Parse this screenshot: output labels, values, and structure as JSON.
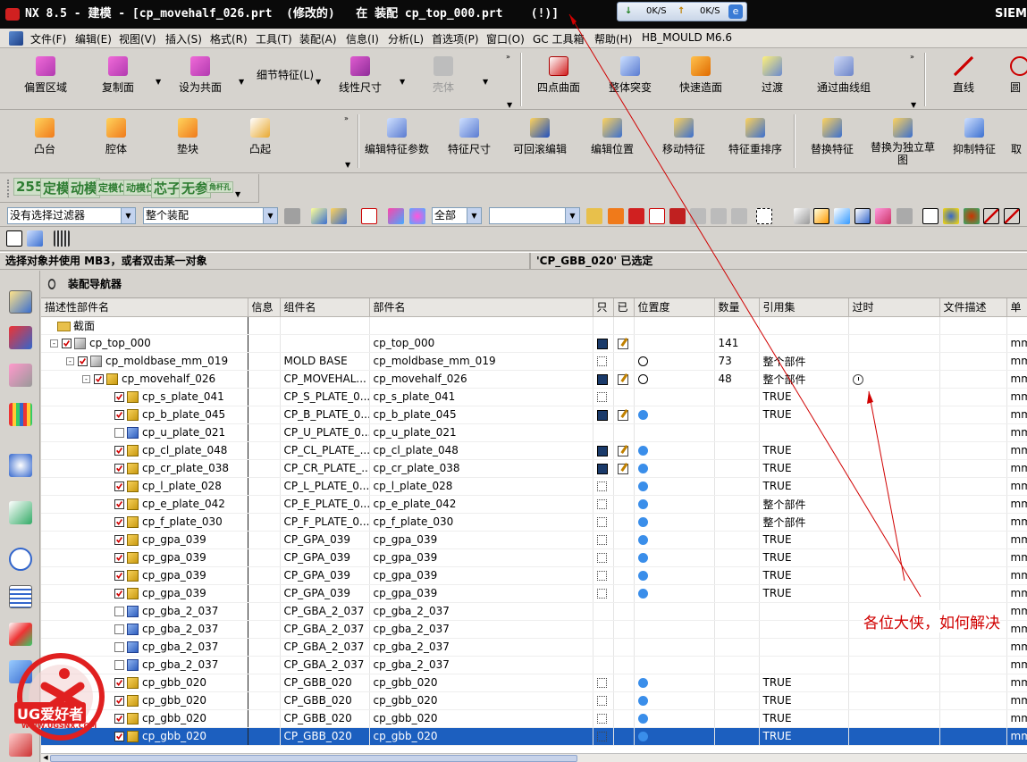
{
  "titlebar": {
    "text": "NX 8.5 - 建模 - [cp_movehalf_026.prt  (修改的)   在 装配 cp_top_000.prt    (!)]",
    "brand": "SIEM",
    "net_down": "0K/S",
    "net_up": "0K/S"
  },
  "menu": [
    "文件(F)",
    "编辑(E)",
    "视图(V)",
    "插入(S)",
    "格式(R)",
    "工具(T)",
    "装配(A)",
    "信息(I)",
    "分析(L)",
    "首选项(P)",
    "窗口(O)",
    "GC 工具箱",
    "帮助(H)",
    "HB_MOULD M6.6"
  ],
  "toolbar1": {
    "buttons": [
      "偏置区域",
      "复制面",
      "设为共面",
      "细节特征(L)",
      "线性尺寸",
      "壳体",
      "四点曲面",
      "整体突变",
      "快速造面",
      "过渡",
      "通过曲线组",
      "直线",
      "圆"
    ]
  },
  "toolbar2": {
    "buttons": [
      "凸台",
      "腔体",
      "垫块",
      "凸起",
      "编辑特征参数",
      "特征尺寸",
      "可回滚编辑",
      "编辑位置",
      "移动特征",
      "特征重排序",
      "替换特征",
      "替换为独立草图",
      "抑制特征",
      "取"
    ]
  },
  "toolbar3": {
    "labels": [
      "255",
      "定模",
      "动模",
      "定模仁",
      "动模仁",
      "芯子",
      "无参",
      "角杆孔"
    ]
  },
  "filters": {
    "selection_filter": "没有选择过滤器",
    "scope": "整个装配",
    "layer": "全部",
    "blank": ""
  },
  "status": {
    "left": "选择对象并使用 MB3，或者双击某一对象",
    "right": "'CP_GBB_020' 已选定"
  },
  "navigator": {
    "title": "装配导航器",
    "columns": [
      "描述性部件名",
      "信息",
      "组件名",
      "部件名",
      "只",
      "已",
      "位置度",
      "数量",
      "引用集",
      "过时",
      "文件描述",
      "单"
    ],
    "section_label": "截面",
    "rows": [
      {
        "name": "cp_top_000",
        "comp": "",
        "part": "cp_top_000",
        "ro": "save",
        "mod": "edit",
        "pos": "",
        "qty": "141",
        "ref": "",
        "old": "",
        "unit": "mm"
      },
      {
        "name": "cp_moldbase_mm_019",
        "comp": "MOLD BASE",
        "part": "cp_moldbase_mm_019",
        "ro": "empty",
        "mod": "",
        "pos": "ring",
        "qty": "73",
        "ref": "整个部件",
        "old": "",
        "unit": "mm"
      },
      {
        "name": "cp_movehalf_026",
        "comp": "CP_MOVEHAL...",
        "part": "cp_movehalf_026",
        "ro": "save",
        "mod": "edit",
        "pos": "ring",
        "qty": "48",
        "ref": "整个部件",
        "old": "clock",
        "unit": "mm"
      },
      {
        "name": "cp_s_plate_041",
        "comp": "CP_S_PLATE_0...",
        "part": "cp_s_plate_041",
        "ro": "empty",
        "mod": "",
        "pos": "",
        "qty": "",
        "ref": "TRUE",
        "old": "",
        "unit": "mm"
      },
      {
        "name": "cp_b_plate_045",
        "comp": "CP_B_PLATE_0...",
        "part": "cp_b_plate_045",
        "ro": "save",
        "mod": "edit",
        "pos": "dot",
        "qty": "",
        "ref": "TRUE",
        "old": "",
        "unit": "mm"
      },
      {
        "name": "cp_u_plate_021",
        "comp": "CP_U_PLATE_0...",
        "part": "cp_u_plate_021",
        "ro": "",
        "mod": "",
        "pos": "",
        "qty": "",
        "ref": "",
        "old": "",
        "unit": "mm"
      },
      {
        "name": "cp_cl_plate_048",
        "comp": "CP_CL_PLATE_...",
        "part": "cp_cl_plate_048",
        "ro": "save",
        "mod": "edit",
        "pos": "dot",
        "qty": "",
        "ref": "TRUE",
        "old": "",
        "unit": "mm"
      },
      {
        "name": "cp_cr_plate_038",
        "comp": "CP_CR_PLATE_...",
        "part": "cp_cr_plate_038",
        "ro": "save",
        "mod": "edit",
        "pos": "dot",
        "qty": "",
        "ref": "TRUE",
        "old": "",
        "unit": "mm"
      },
      {
        "name": "cp_l_plate_028",
        "comp": "CP_L_PLATE_0...",
        "part": "cp_l_plate_028",
        "ro": "empty",
        "mod": "",
        "pos": "dot",
        "qty": "",
        "ref": "TRUE",
        "old": "",
        "unit": "mm"
      },
      {
        "name": "cp_e_plate_042",
        "comp": "CP_E_PLATE_0...",
        "part": "cp_e_plate_042",
        "ro": "empty",
        "mod": "",
        "pos": "dot",
        "qty": "",
        "ref": "整个部件",
        "old": "",
        "unit": "mm"
      },
      {
        "name": "cp_f_plate_030",
        "comp": "CP_F_PLATE_0...",
        "part": "cp_f_plate_030",
        "ro": "empty",
        "mod": "",
        "pos": "dot",
        "qty": "",
        "ref": "整个部件",
        "old": "",
        "unit": "mm"
      },
      {
        "name": "cp_gpa_039",
        "comp": "CP_GPA_039",
        "part": "cp_gpa_039",
        "ro": "empty",
        "mod": "",
        "pos": "dot",
        "qty": "",
        "ref": "TRUE",
        "old": "",
        "unit": "mm"
      },
      {
        "name": "cp_gpa_039",
        "comp": "CP_GPA_039",
        "part": "cp_gpa_039",
        "ro": "empty",
        "mod": "",
        "pos": "dot",
        "qty": "",
        "ref": "TRUE",
        "old": "",
        "unit": "mm"
      },
      {
        "name": "cp_gpa_039",
        "comp": "CP_GPA_039",
        "part": "cp_gpa_039",
        "ro": "empty",
        "mod": "",
        "pos": "dot",
        "qty": "",
        "ref": "TRUE",
        "old": "",
        "unit": "mm"
      },
      {
        "name": "cp_gpa_039",
        "comp": "CP_GPA_039",
        "part": "cp_gpa_039",
        "ro": "empty",
        "mod": "",
        "pos": "dot",
        "qty": "",
        "ref": "TRUE",
        "old": "",
        "unit": "mm"
      },
      {
        "name": "cp_gba_2_037",
        "comp": "CP_GBA_2_037",
        "part": "cp_gba_2_037",
        "ro": "",
        "mod": "",
        "pos": "",
        "qty": "",
        "ref": "",
        "old": "",
        "unit": "mm"
      },
      {
        "name": "cp_gba_2_037",
        "comp": "CP_GBA_2_037",
        "part": "cp_gba_2_037",
        "ro": "",
        "mod": "",
        "pos": "",
        "qty": "",
        "ref": "",
        "old": "",
        "unit": "mm"
      },
      {
        "name": "cp_gba_2_037",
        "comp": "CP_GBA_2_037",
        "part": "cp_gba_2_037",
        "ro": "",
        "mod": "",
        "pos": "",
        "qty": "",
        "ref": "",
        "old": "",
        "unit": "mm"
      },
      {
        "name": "cp_gba_2_037",
        "comp": "CP_GBA_2_037",
        "part": "cp_gba_2_037",
        "ro": "",
        "mod": "",
        "pos": "",
        "qty": "",
        "ref": "",
        "old": "",
        "unit": "mm"
      },
      {
        "name": "cp_gbb_020",
        "comp": "CP_GBB_020",
        "part": "cp_gbb_020",
        "ro": "empty",
        "mod": "",
        "pos": "dot",
        "qty": "",
        "ref": "TRUE",
        "old": "",
        "unit": "mm"
      },
      {
        "name": "cp_gbb_020",
        "comp": "CP_GBB_020",
        "part": "cp_gbb_020",
        "ro": "empty",
        "mod": "",
        "pos": "dot",
        "qty": "",
        "ref": "TRUE",
        "old": "",
        "unit": "mm"
      },
      {
        "name": "cp_gbb_020",
        "comp": "CP_GBB_020",
        "part": "cp_gbb_020",
        "ro": "empty",
        "mod": "",
        "pos": "dot",
        "qty": "",
        "ref": "TRUE",
        "old": "",
        "unit": "mm"
      },
      {
        "name": "cp_gbb_020",
        "comp": "CP_GBB_020",
        "part": "cp_gbb_020",
        "ro": "empty",
        "mod": "",
        "pos": "dot",
        "qty": "",
        "ref": "TRUE",
        "old": "",
        "unit": "mm",
        "selected": true
      }
    ]
  },
  "annotation": "各位大侠，如何解决",
  "watermark": {
    "line1": "UG爱好者",
    "line2": "WWW.UGSNX.COM"
  }
}
